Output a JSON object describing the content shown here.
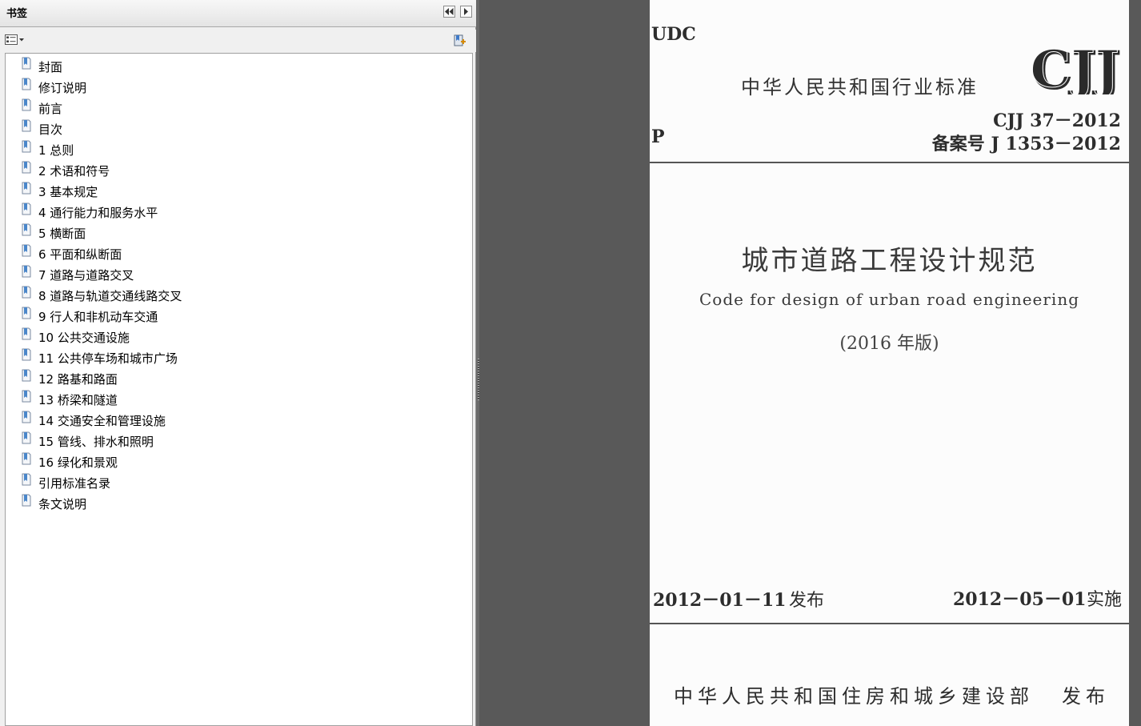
{
  "bookmarks_panel": {
    "title": "书签",
    "collapse_button": "◀◀",
    "expand_button": "▶",
    "options_icon": "options-menu-icon",
    "new_bookmark_icon": "new-bookmark-icon",
    "items": [
      {
        "label": "封面"
      },
      {
        "label": "修订说明"
      },
      {
        "label": "前言"
      },
      {
        "label": "目次"
      },
      {
        "label": "1 总则"
      },
      {
        "label": "2 术语和符号"
      },
      {
        "label": "3 基本规定"
      },
      {
        "label": "4 通行能力和服务水平"
      },
      {
        "label": "5 横断面"
      },
      {
        "label": "6 平面和纵断面"
      },
      {
        "label": "7 道路与道路交叉"
      },
      {
        "label": "8 道路与轨道交通线路交叉"
      },
      {
        "label": "9 行人和非机动车交通"
      },
      {
        "label": "10 公共交通设施"
      },
      {
        "label": "11 公共停车场和城市广场"
      },
      {
        "label": "12 路基和路面"
      },
      {
        "label": "13 桥梁和隧道"
      },
      {
        "label": "14 交通安全和管理设施"
      },
      {
        "label": "15 管线、排水和照明"
      },
      {
        "label": "16 绿化和景观"
      },
      {
        "label": "引用标准名录"
      },
      {
        "label": "条文说明"
      }
    ]
  },
  "document": {
    "udc": "UDC",
    "category": "P",
    "standard_type": "中华人民共和国行业标准",
    "logo_text": "CJJ",
    "standard_number": "CJJ 37－2012",
    "record_number": "备案号 J 1353－2012",
    "title_zh": "城市道路工程设计规范",
    "title_en": "Code for design of urban road engineering",
    "edition": "(2016 年版)",
    "issue_date": "2012－01－11",
    "issue_label": "发布",
    "implement_date": "2012－05－01",
    "implement_label": "实施",
    "publisher": "中华人民共和国住房和城乡建设部",
    "publisher_label": "发布"
  },
  "colors": {
    "viewer_background": "#595959",
    "panel_background": "#f0f0f0",
    "page_background": "#fcfcfc",
    "bookmark_icon": "#7a8aa0"
  }
}
